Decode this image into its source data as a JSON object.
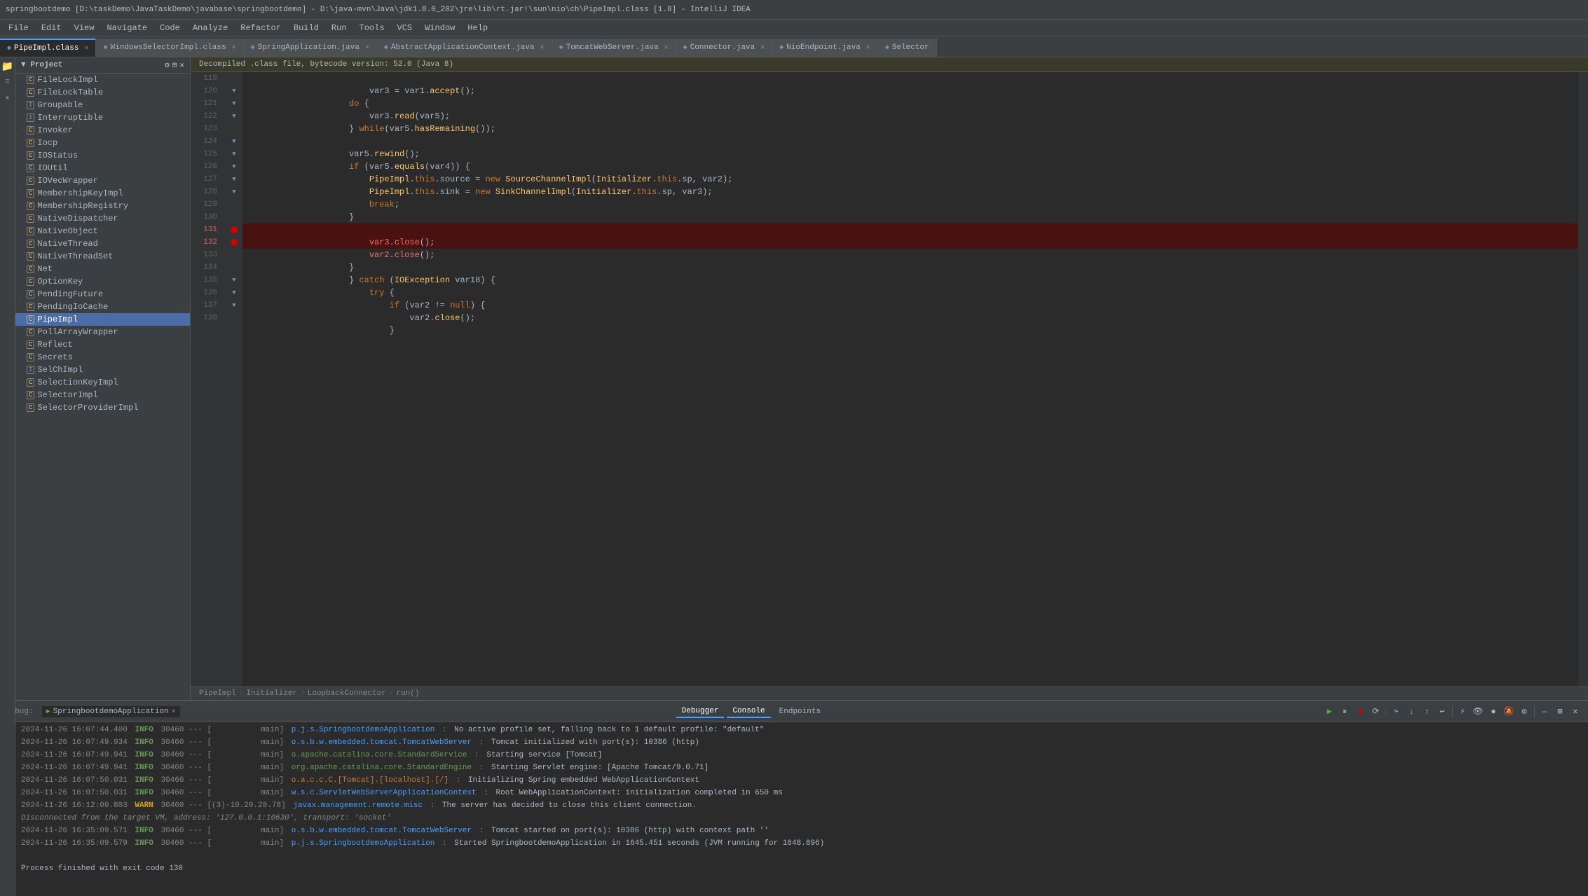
{
  "titleBar": {
    "text": "springbootdemo [D:\\taskDemo\\JavaTaskDemo\\javabase\\springbootdemo] - D:\\java-mvn\\Java\\jdk1.8.0_202\\jre\\lib\\rt.jar!\\sun\\nio\\ch\\PipeImpl.class [1.8] - IntelliJ IDEA"
  },
  "menuBar": {
    "items": [
      "File",
      "Edit",
      "View",
      "Navigate",
      "Code",
      "Analyze",
      "Refactor",
      "Build",
      "Run",
      "Tools",
      "VCS",
      "Window",
      "Help"
    ]
  },
  "tabs": [
    {
      "label": "PipeImpl.class",
      "active": true,
      "closable": true
    },
    {
      "label": "WindowsSelectorImpl.class",
      "active": false,
      "closable": true
    },
    {
      "label": "SpringApplication.java",
      "active": false,
      "closable": true
    },
    {
      "label": "AbstractApplicationContext.java",
      "active": false,
      "closable": true
    },
    {
      "label": "TomcatWebServer.java",
      "active": false,
      "closable": true
    },
    {
      "label": "Connector.java",
      "active": false,
      "closable": true
    },
    {
      "label": "NioEndpoint.java",
      "active": false,
      "closable": true
    },
    {
      "label": "Selector",
      "active": false,
      "closable": false
    }
  ],
  "decompileBanner": "Decompiled .class file, bytecode version: 52.0 (Java 8)",
  "sidebarHeader": "Project",
  "sidebarItems": [
    {
      "label": "FileLockImpl",
      "icon": "C"
    },
    {
      "label": "FileLockTable",
      "icon": "C"
    },
    {
      "label": "Groupable",
      "icon": "I"
    },
    {
      "label": "Interruptible",
      "icon": "I"
    },
    {
      "label": "Invoker",
      "icon": "C"
    },
    {
      "label": "Iocp",
      "icon": "C"
    },
    {
      "label": "IOStatus",
      "icon": "C"
    },
    {
      "label": "IOUtil",
      "icon": "C"
    },
    {
      "label": "IOVecWrapper",
      "icon": "C"
    },
    {
      "label": "MembershipKeyImpl",
      "icon": "C"
    },
    {
      "label": "MembershipRegistry",
      "icon": "C"
    },
    {
      "label": "NativeDispatcher",
      "icon": "C"
    },
    {
      "label": "NativeObject",
      "icon": "C"
    },
    {
      "label": "NativeThread",
      "icon": "C"
    },
    {
      "label": "NativeThreadSet",
      "icon": "C"
    },
    {
      "label": "Net",
      "icon": "C"
    },
    {
      "label": "OptionKey",
      "icon": "C"
    },
    {
      "label": "PendingFuture",
      "icon": "C"
    },
    {
      "label": "PendingIoCache",
      "icon": "C"
    },
    {
      "label": "PipeImpl",
      "icon": "C",
      "active": true
    },
    {
      "label": "PollArrayWrapper",
      "icon": "C"
    },
    {
      "label": "Reflect",
      "icon": "C"
    },
    {
      "label": "Secrets",
      "icon": "C"
    },
    {
      "label": "SelChImpl",
      "icon": "I"
    },
    {
      "label": "SelectionKeyImpl",
      "icon": "C"
    },
    {
      "label": "SelectorImpl",
      "icon": "C"
    },
    {
      "label": "SelectorProviderImpl",
      "icon": "C"
    }
  ],
  "codeLines": [
    {
      "num": "119",
      "gutter": "",
      "content": "            var3 = var1.accept();",
      "highlight": false,
      "breakpoint": false
    },
    {
      "num": "120",
      "gutter": "arrow",
      "content": "        do {",
      "highlight": false,
      "breakpoint": false
    },
    {
      "num": "121",
      "gutter": "arrow",
      "content": "            var3.read(var5);",
      "highlight": false,
      "breakpoint": false
    },
    {
      "num": "122",
      "gutter": "arrow",
      "content": "        } while(var5.hasRemaining());",
      "highlight": false,
      "breakpoint": false
    },
    {
      "num": "123",
      "gutter": "",
      "content": "",
      "highlight": false,
      "breakpoint": false
    },
    {
      "num": "124",
      "gutter": "arrow",
      "content": "        var5.rewind();",
      "highlight": false,
      "breakpoint": false
    },
    {
      "num": "125",
      "gutter": "arrow",
      "content": "        if (var5.equals(var4)) {",
      "highlight": false,
      "breakpoint": false
    },
    {
      "num": "126",
      "gutter": "arrow",
      "content": "            PipeImpl.this.source = new SourceChannelImpl(Initializer.this.sp, var2);",
      "highlight": false,
      "breakpoint": false
    },
    {
      "num": "127",
      "gutter": "arrow",
      "content": "            PipeImpl.this.sink = new SinkChannelImpl(Initializer.this.sp, var3);",
      "highlight": false,
      "breakpoint": false
    },
    {
      "num": "128",
      "gutter": "arrow",
      "content": "            break;",
      "highlight": false,
      "breakpoint": false
    },
    {
      "num": "129",
      "gutter": "",
      "content": "        }",
      "highlight": false,
      "breakpoint": false
    },
    {
      "num": "130",
      "gutter": "",
      "content": "",
      "highlight": false,
      "breakpoint": false
    },
    {
      "num": "131",
      "gutter": "",
      "content": "        var3.close();",
      "highlight": true,
      "breakpoint": true
    },
    {
      "num": "132",
      "gutter": "",
      "content": "        var2.close();",
      "highlight": true,
      "breakpoint": true
    },
    {
      "num": "133",
      "gutter": "",
      "content": "    }",
      "highlight": false,
      "breakpoint": false
    },
    {
      "num": "134",
      "gutter": "",
      "content": "} catch (IOException var18) {",
      "highlight": false,
      "breakpoint": false
    },
    {
      "num": "135",
      "gutter": "arrow",
      "content": "    try {",
      "highlight": false,
      "breakpoint": false
    },
    {
      "num": "136",
      "gutter": "arrow",
      "content": "        if (var2 != null) {",
      "highlight": false,
      "breakpoint": false
    },
    {
      "num": "137",
      "gutter": "arrow",
      "content": "            var2.close();",
      "highlight": false,
      "breakpoint": false
    },
    {
      "num": "138",
      "gutter": "",
      "content": "        }",
      "highlight": false,
      "breakpoint": false
    }
  ],
  "breadcrumb": {
    "parts": [
      "PipeImpl",
      "Initializer",
      "LoopbackConnector",
      "run()"
    ]
  },
  "debugBar": {
    "appName": "SpringbootdemoApplication",
    "closable": true
  },
  "bottomTabs": [
    {
      "label": "Debugger",
      "active": false
    },
    {
      "label": "Console",
      "active": true
    },
    {
      "label": "Endpoints",
      "active": false
    }
  ],
  "consoleLogo": {
    "label": "SpringbootdemoApplication"
  },
  "consoleLines": [
    {
      "time": "2024-11-26 16:07:44.400",
      "level": "INFO",
      "pid": "30460",
      "thread": "---  [",
      "threadName": "main]",
      "class": "p.j.s.SpringbootdemoApplication",
      "separator": ":",
      "message": "No active profile set, falling back to 1 default profile: \"default\""
    },
    {
      "time": "2024-11-26 16:07:49.934",
      "level": "INFO",
      "pid": "30460",
      "thread": "---  [",
      "threadName": "main]",
      "class": "o.s.b.w.embedded.tomcat.TomcatWebServer",
      "separator": ":",
      "message": "Tomcat initialized with port(s): 10386 (http)"
    },
    {
      "time": "2024-11-26 16:07:49.941",
      "level": "INFO",
      "pid": "30460",
      "thread": "---  [",
      "threadName": "main]",
      "class": "o.apache.catalina.core.StandardService",
      "separator": ":",
      "message": "Starting service [Tomcat]"
    },
    {
      "time": "2024-11-26 16:07:49.941",
      "level": "INFO",
      "pid": "30460",
      "thread": "---  [",
      "threadName": "main]",
      "class": "org.apache.catalina.core.StandardEngine",
      "separator": ":",
      "message": "Starting Servlet engine: [Apache Tomcat/9.0.71]"
    },
    {
      "time": "2024-11-26 16:07:50.031",
      "level": "INFO",
      "pid": "30460",
      "thread": "---  [",
      "threadName": "main]",
      "class": "o.a.c.c.C.[Tomcat].[localhost].[/]",
      "separator": ":",
      "message": "Initializing Spring embedded WebApplicationContext"
    },
    {
      "time": "2024-11-26 16:07:50.031",
      "level": "INFO",
      "pid": "30460",
      "thread": "---  [",
      "threadName": "main]",
      "class": "w.s.c.ServletWebServerApplicationContext",
      "separator": ":",
      "message": "Root WebApplicationContext: initialization completed in 650 ms"
    },
    {
      "time": "2024-11-26 16:12:00.803",
      "level": "WARN",
      "pid": "30460",
      "thread": "--- [(3)-10.20.20.78]",
      "threadName": "",
      "class": "javax.management.remote.misc",
      "separator": ":",
      "message": "The server has decided to close this client connection."
    },
    {
      "time": "",
      "level": "",
      "pid": "",
      "thread": "",
      "threadName": "",
      "class": "",
      "separator": "",
      "message": "Disconnected from the target VM, address: '127.0.0.1:10630', transport: 'socket'",
      "special": true
    },
    {
      "time": "2024-11-26 16:35:09.571",
      "level": "INFO",
      "pid": "30460",
      "thread": "---  [",
      "threadName": "main]",
      "class": "o.s.b.w.embedded.tomcat.TomcatWebServer",
      "separator": ":",
      "message": "Tomcat started on port(s): 10386 (http) with context path ''"
    },
    {
      "time": "2024-11-26 16:35:09.579",
      "level": "INFO",
      "pid": "30460",
      "thread": "---  [",
      "threadName": "main]",
      "class": "p.j.s.SpringbootdemoApplication",
      "separator": ":",
      "message": "Started SpringbootdemoApplication in 1645.451 seconds (JVM running for 1648.896)"
    },
    {
      "time": "",
      "level": "",
      "pid": "",
      "thread": "",
      "threadName": "",
      "class": "",
      "separator": "",
      "message": "",
      "special": false
    },
    {
      "time": "",
      "level": "",
      "pid": "",
      "thread": "",
      "threadName": "",
      "class": "",
      "separator": "",
      "message": "Process finished with exit code 130",
      "special": true
    }
  ],
  "leftIcons": [
    "▶",
    "⏸",
    "⏹",
    "⟳",
    "▼",
    "▲",
    "⬇",
    "⬆",
    "↩",
    "✕",
    "⚡",
    "📋",
    "⚙",
    "🔍",
    "⊞"
  ],
  "colors": {
    "accent": "#4a9eff",
    "breakpoint": "#cc0000",
    "activeTab": "#2b2b2b",
    "infoColor": "#6a9955",
    "warnColor": "#d4a017"
  }
}
